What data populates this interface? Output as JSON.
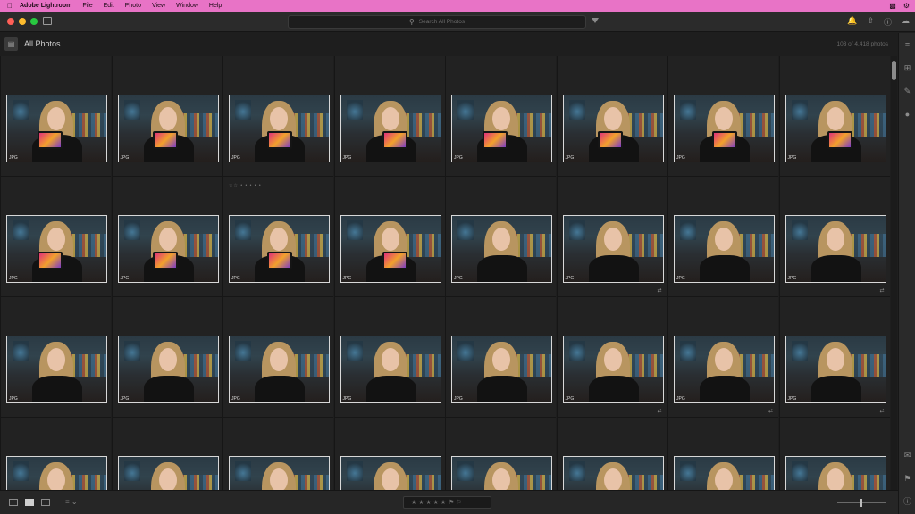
{
  "menubar": {
    "app_name": "Adobe Lightroom",
    "items": [
      "File",
      "Edit",
      "Photo",
      "View",
      "Window",
      "Help"
    ]
  },
  "toolbar": {
    "search_placeholder": "Search All Photos"
  },
  "header": {
    "title": "All Photos",
    "count": "103 of 4,418 photos"
  },
  "photo_tag": "JPG",
  "row_meta": "☆☆ • • • • •",
  "bottom": {
    "stars": "★ ★ ★ ★ ★",
    "flags": "⚑ ⚐"
  }
}
